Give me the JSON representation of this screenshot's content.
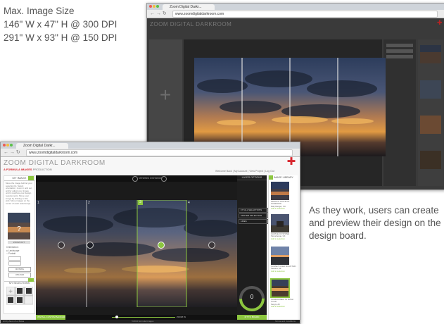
{
  "spec": {
    "title": "Max. Image Size",
    "line1": "146\" W x 47\" H @ 300 DPI",
    "line2": "291\" W x 93\" H @ 150 DPI"
  },
  "caption": "As they work, users can create and preview their design on the design board.",
  "back_window": {
    "tab_title": "Zoom Digital Darkr...",
    "url": "www.zoomdigitaldarkroom.com",
    "app_title": "ZOOM DIGITAL DARKROOM"
  },
  "front_window": {
    "tab_title": "Zoom Digital Darkr...",
    "url": "www.zoomdigitaldarkroom.com",
    "app_title": "ZOOM DIGITAL DARKROOM",
    "subtitle_brand": "A FORMULA IMAGES",
    "subtitle_rest": "PRODUCTION",
    "top_links": "Welcome Back | My Account | View Project | Log Out",
    "left_panel": {
      "header": "MY IMAGE",
      "help_text": "Move the image behind your selection(s). Select orientation, zoom in and out, and/or adjust your image until it matches your design requirements. Move your image by clicking on the pink. Move images on the center of each selection(s).",
      "zoom_out": "ZOOM OUT",
      "orient_label": "Orientation:",
      "opt1": "Landscape",
      "opt2": "Portrait",
      "btn1": "ROTATE",
      "btn2": "UPLOAD",
      "selections_header": "MY SELECTIONS"
    },
    "board": {
      "top_label": "VIEWING DISTANCE",
      "panel_numbers": [
        "1",
        "2",
        "3",
        "4"
      ],
      "bottom_left": "INSTALL CUSTOM BACKGROUND",
      "bottom_center": "ZOOM IN",
      "bottom_right": "FIT TO BOARD",
      "footer_center": "©2013 Formula Images",
      "footer_right": "Terms and Conditions",
      "footer_left": "Art by Alex of Lo Bolsa"
    },
    "layer_options": {
      "header": "LAYER OPTIONS",
      "items": [
        "FIT ALL SELECTIONS",
        "CENTER SELECTION",
        "LINES"
      ],
      "gauge_value": "0"
    },
    "library": {
      "header": "IMAGE LIBRARY",
      "items": [
        {
          "title": "PRONTO CLOUD AT SUNDOWN",
          "meta": "Daly Ranger, CA",
          "status": "Add to selection"
        },
        {
          "title": "CASTLE OF STONE",
          "meta": "Stonehenge, UK",
          "status": "Add to selection"
        },
        {
          "title": "SUNSET OVER MOUNTAIN",
          "meta": "Sedona, AZ",
          "status": "Add to selection"
        },
        {
          "title": "SUNDOWNER TO BUSH TOUR",
          "meta": "Kenya, AF",
          "status": "Add to selection"
        }
      ]
    }
  },
  "colors": {
    "accent_green": "#8cc63f",
    "brand_red": "#d7262d",
    "board_dark": "#1b1b1b"
  }
}
